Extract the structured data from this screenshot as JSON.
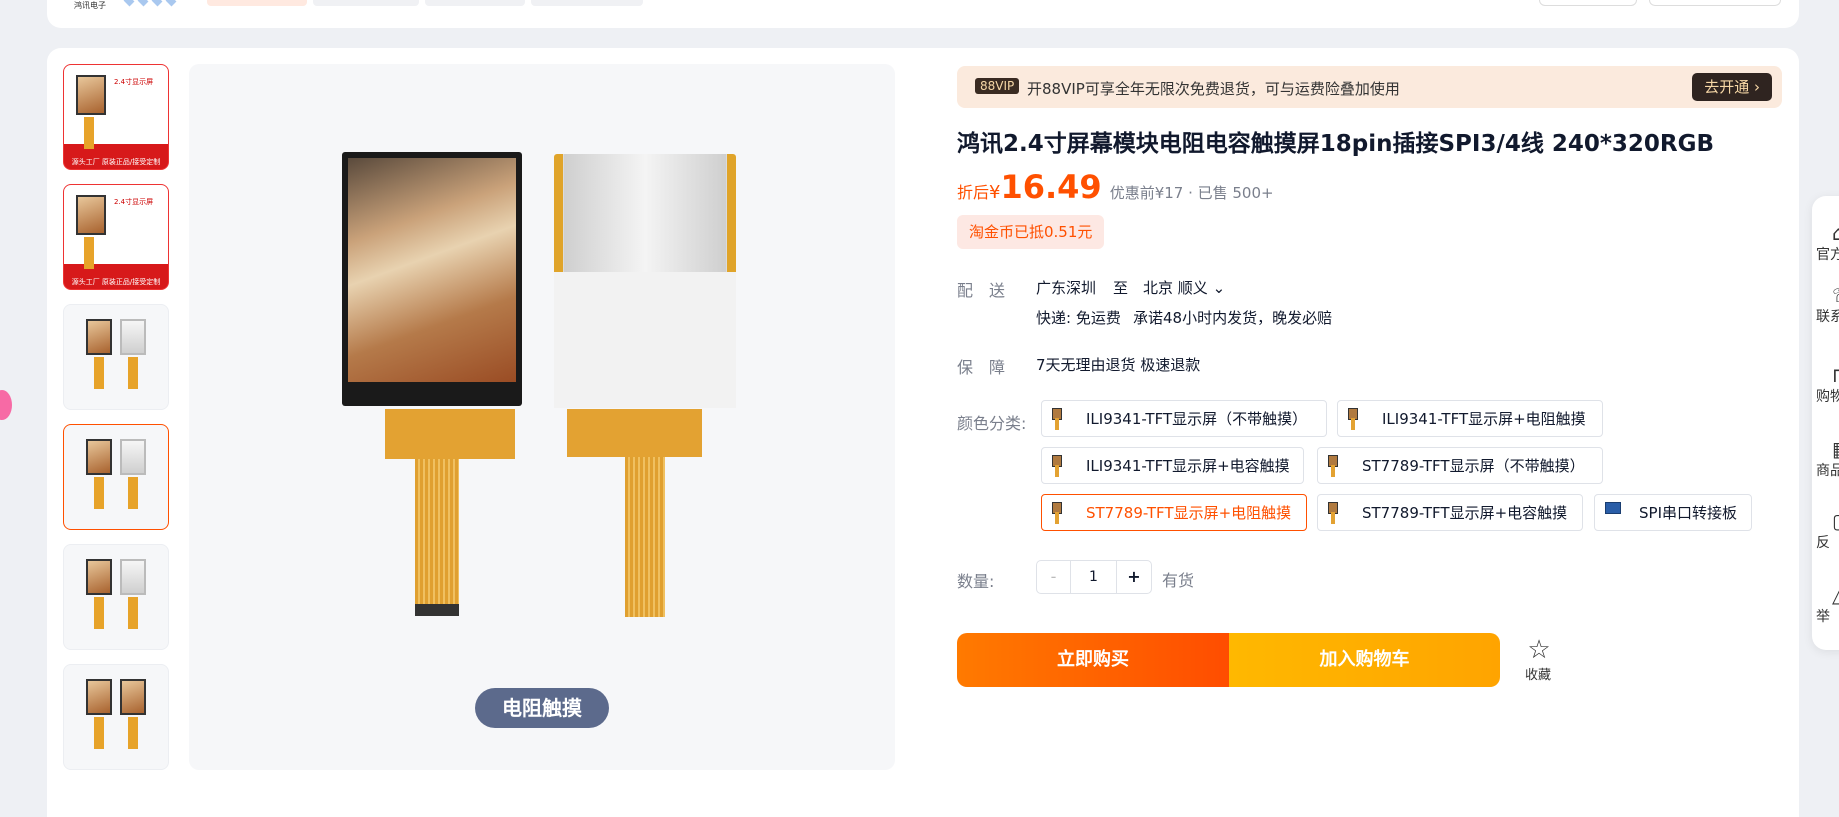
{
  "topbar": {
    "shop_name": "鸿讯电子"
  },
  "gallery": {
    "thumbs": [
      {
        "title": "2.4寸显示屏",
        "footer": "源头工厂 原装正品/接受定制"
      },
      {
        "title": "2.4寸显示屏",
        "footer": "源头工厂 原装正品/接受定制"
      },
      {
        "title": ""
      },
      {
        "title": ""
      },
      {
        "title": ""
      },
      {
        "title": ""
      }
    ],
    "main_badge": "电阻触摸"
  },
  "vip": {
    "tag": "88VIP",
    "text": "开88VIP可享全年无限次免费退货，可与运费险叠加使用",
    "button": "去开通 ›"
  },
  "product": {
    "title": "鸿讯2.4寸屏幕模块电阻电容触摸屏18pin插接SPI3/4线 240*320RGB",
    "price_label": "折后",
    "price_symbol": "¥",
    "price": "16.49",
    "price_sub": "优惠前¥17 · 已售 500+",
    "coin_text": "淘金币已抵0.51元"
  },
  "delivery": {
    "label": "配送",
    "from": "广东深圳",
    "to_word": "至",
    "to": "北京 顺义",
    "express": "快递: 免运费",
    "promise": "承诺48小时内发货，晚发必赔"
  },
  "guarantee": {
    "label": "保障",
    "text": "7天无理由退货 极速退款"
  },
  "sku": {
    "label": "颜色分类:",
    "options": [
      "ILI9341-TFT显示屏（不带触摸）",
      "ILI9341-TFT显示屏+电阻触摸",
      "ILI9341-TFT显示屏+电容触摸",
      "ST7789-TFT显示屏（不带触摸）",
      "ST7789-TFT显示屏+电阻触摸",
      "ST7789-TFT显示屏+电容触摸",
      "SPI串口转接板"
    ],
    "selected_index": 4
  },
  "quantity": {
    "label": "数量:",
    "minus": "-",
    "value": "1",
    "plus": "+",
    "stock": "有货"
  },
  "actions": {
    "buy": "立即购买",
    "cart": "加入购物车",
    "favorite": "收藏"
  },
  "sidebar": [
    {
      "icon": "shop-icon",
      "label": "官方"
    },
    {
      "icon": "contact-icon",
      "label": "联系"
    },
    {
      "icon": "cart-icon",
      "label": "购物"
    },
    {
      "icon": "product-icon",
      "label": "商品"
    },
    {
      "icon": "feedback-icon",
      "label": "反"
    },
    {
      "icon": "report-icon",
      "label": "举"
    }
  ],
  "colors": {
    "accent": "#ff5000",
    "buy_from": "#ff7a00",
    "cart_from": "#ffb800"
  }
}
